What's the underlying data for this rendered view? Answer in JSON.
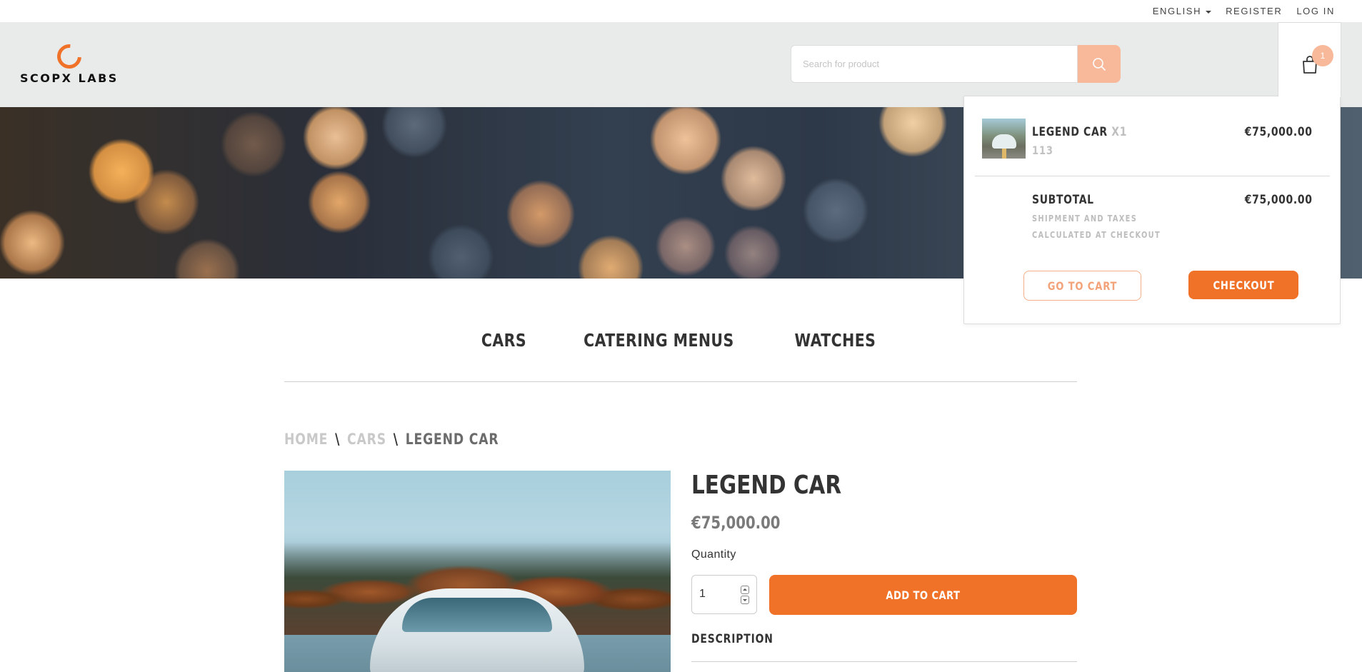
{
  "topbar": {
    "language": "ENGLISH",
    "register": "REGISTER",
    "login": "LOG IN"
  },
  "logo": {
    "text": "SCOPX LABS"
  },
  "search": {
    "placeholder": "Search for product",
    "icon": "search-icon"
  },
  "cart": {
    "count": "1",
    "icon": "shopping-bag-icon"
  },
  "categories": [
    "CARS",
    "CATERING MENUS",
    "WATCHES"
  ],
  "breadcrumb": {
    "home": "HOME",
    "sep": "\\",
    "section": "CARS",
    "current": "LEGEND CAR"
  },
  "product": {
    "title": "LEGEND CAR",
    "price": "€75,000.00",
    "quantity_label": "Quantity",
    "quantity_value": "1",
    "add_to_cart": "ADD TO CART",
    "description_heading": "DESCRIPTION"
  },
  "cart_dropdown": {
    "item_name": "LEGEND CAR",
    "item_qty": "X1",
    "item_sku": "113",
    "item_price": "€75,000.00",
    "subtotal_label": "SUBTOTAL",
    "subtotal_value": "€75,000.00",
    "note": "SHIPMENT AND TAXES CALCULATED AT CHECKOUT",
    "go_to_cart": "GO TO CART",
    "checkout": "CHECKOUT"
  },
  "colors": {
    "accent": "#f07128",
    "accent_light": "#f8b99a",
    "header_bg": "#e9eaea"
  }
}
